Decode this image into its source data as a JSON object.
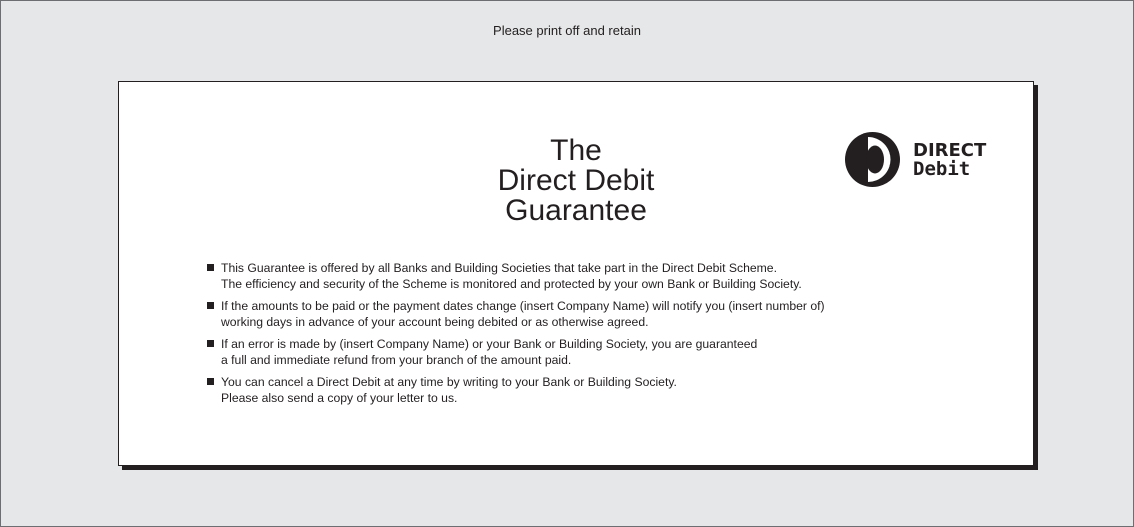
{
  "header": {
    "print_note": "Please print off and retain"
  },
  "logo": {
    "line1": "DIRECT",
    "line2": "Debit",
    "icon": "direct-debit-logo-icon"
  },
  "guarantee": {
    "title_line1": "The",
    "title_line2": "Direct Debit",
    "title_line3": "Guarantee",
    "items": [
      {
        "line1": "This Guarantee is offered by all Banks and Building Societies that take part in the Direct Debit Scheme.",
        "line2": "The efficiency and security of the Scheme is monitored and protected by your own Bank or Building Society."
      },
      {
        "line1": "If the amounts to be paid or the payment dates change (insert Company Name) will notify you (insert number of)",
        "line2": "working days in advance of your account being debited or as otherwise agreed."
      },
      {
        "line1": "If an error is made by (insert Company Name) or your Bank or Building Society, you are guaranteed",
        "line2": "a full and immediate refund from your branch of the amount paid."
      },
      {
        "line1": "You can cancel a Direct Debit at any time by writing to your Bank or Building Society.",
        "line2": "Please also send a copy of your letter to us."
      }
    ]
  },
  "colors": {
    "page_background": "#e6e7e8",
    "card_background": "#ffffff",
    "text": "#231f20",
    "border": "#6d6e71"
  }
}
